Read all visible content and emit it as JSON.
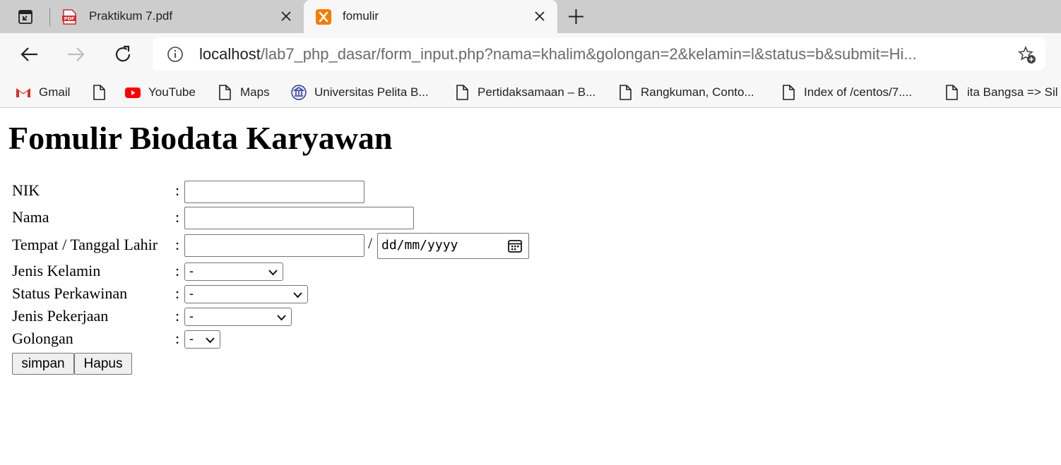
{
  "tabs": [
    {
      "title": "Praktikum 7.pdf",
      "icon": "pdf-icon",
      "active": false
    },
    {
      "title": "fomulir",
      "icon": "xampp-icon",
      "active": true
    }
  ],
  "address": {
    "host": "localhost",
    "path": "/lab7_php_dasar/form_input.php?nama=khalim&golongan=2&kelamin=l&status=b&submit=Hi..."
  },
  "bookmarks": [
    {
      "label": "Gmail",
      "icon": "gmail-icon"
    },
    {
      "label": "",
      "icon": "page-icon"
    },
    {
      "label": "YouTube",
      "icon": "youtube-icon"
    },
    {
      "label": "Maps",
      "icon": "page-icon"
    },
    {
      "label": "Universitas Pelita B...",
      "icon": "university-icon"
    },
    {
      "label": "Pertidaksamaan – B...",
      "icon": "page-icon"
    },
    {
      "label": "Rangkuman, Conto...",
      "icon": "page-icon"
    },
    {
      "label": "Index of /centos/7....",
      "icon": "page-icon"
    },
    {
      "label": "ita Bangsa => Sil",
      "icon": "page-icon"
    }
  ],
  "page": {
    "heading": "Fomulir Biodata Karyawan",
    "colon": ":",
    "slash": "/",
    "labels": {
      "nik": "NIK",
      "nama": "Nama",
      "ttl": "Tempat / Tanggal Lahir",
      "kelamin": "Jenis Kelamin",
      "status": "Status Perkawinan",
      "pekerjaan": "Jenis Pekerjaan",
      "golongan": "Golongan"
    },
    "fields": {
      "nik": "",
      "nama": "",
      "tempat": "",
      "tanggal_placeholder": "dd/mm/yyyy"
    },
    "selects": {
      "kelamin": "-",
      "status": "-",
      "pekerjaan": "-",
      "golongan": "-"
    },
    "buttons": {
      "simpan": "simpan",
      "hapus": "Hapus"
    }
  }
}
